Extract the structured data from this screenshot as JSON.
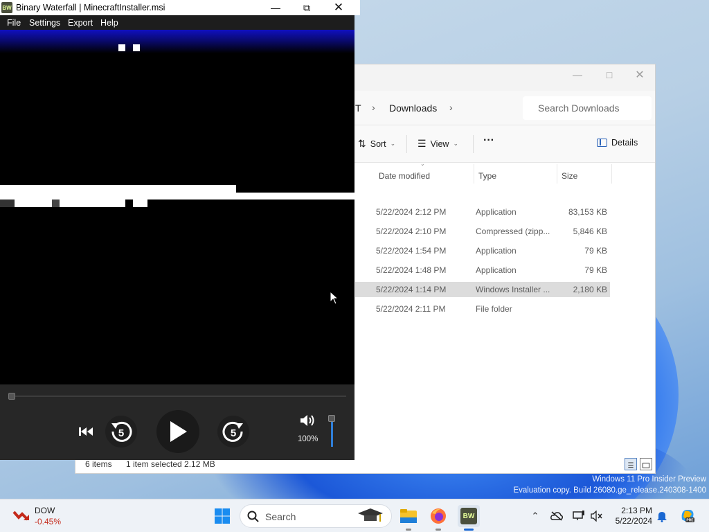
{
  "binary_waterfall": {
    "title": "Binary Waterfall | MinecraftInstaller.msi",
    "app_icon": "BW",
    "menu": [
      "File",
      "Settings",
      "Export",
      "Help"
    ],
    "volume_label": "100%",
    "volume_level": 1.0,
    "seek_position": 0.0,
    "icons": [
      "skip-back-icon",
      "rewind-5-icon",
      "play-icon",
      "forward-5-icon",
      "speaker-icon"
    ],
    "skip_label": "5"
  },
  "explorer": {
    "breadcrumb_partial": "T",
    "breadcrumb_current": "Downloads",
    "search_placeholder": "Search Downloads",
    "commands": {
      "sort": "Sort",
      "view": "View",
      "more": "···",
      "details": "Details"
    },
    "columns": {
      "date": "Date modified",
      "type": "Type",
      "size": "Size"
    },
    "rows": [
      {
        "date": "5/22/2024 2:12 PM",
        "type": "Application",
        "size": "83,153 KB",
        "selected": false
      },
      {
        "date": "5/22/2024 2:10 PM",
        "type": "Compressed (zipp...",
        "size": "5,846 KB",
        "selected": false
      },
      {
        "date": "5/22/2024 1:54 PM",
        "type": "Application",
        "size": "79 KB",
        "selected": false
      },
      {
        "date": "5/22/2024 1:48 PM",
        "type": "Application",
        "size": "79 KB",
        "selected": false
      },
      {
        "date": "5/22/2024 1:14 PM",
        "type": "Windows Installer ...",
        "size": "2,180 KB",
        "selected": true
      },
      {
        "date": "5/22/2024 2:11 PM",
        "type": "File folder",
        "size": "",
        "selected": false
      }
    ],
    "status": {
      "items": "6 items",
      "selected": "1 item selected  2.12 MB"
    }
  },
  "watermark": {
    "line1": "Windows 11 Pro Insider Preview",
    "line2": "Evaluation copy. Build 26080.ge_release.240308-1400"
  },
  "taskbar": {
    "stock_name": "DOW",
    "stock_change": "-0.45%",
    "search_label": "Search",
    "bw_icon": "BW",
    "time": "2:13 PM",
    "date": "5/22/2024",
    "colors": {
      "stock_negative": "#c42b1c",
      "accent": "#1967d2"
    }
  }
}
